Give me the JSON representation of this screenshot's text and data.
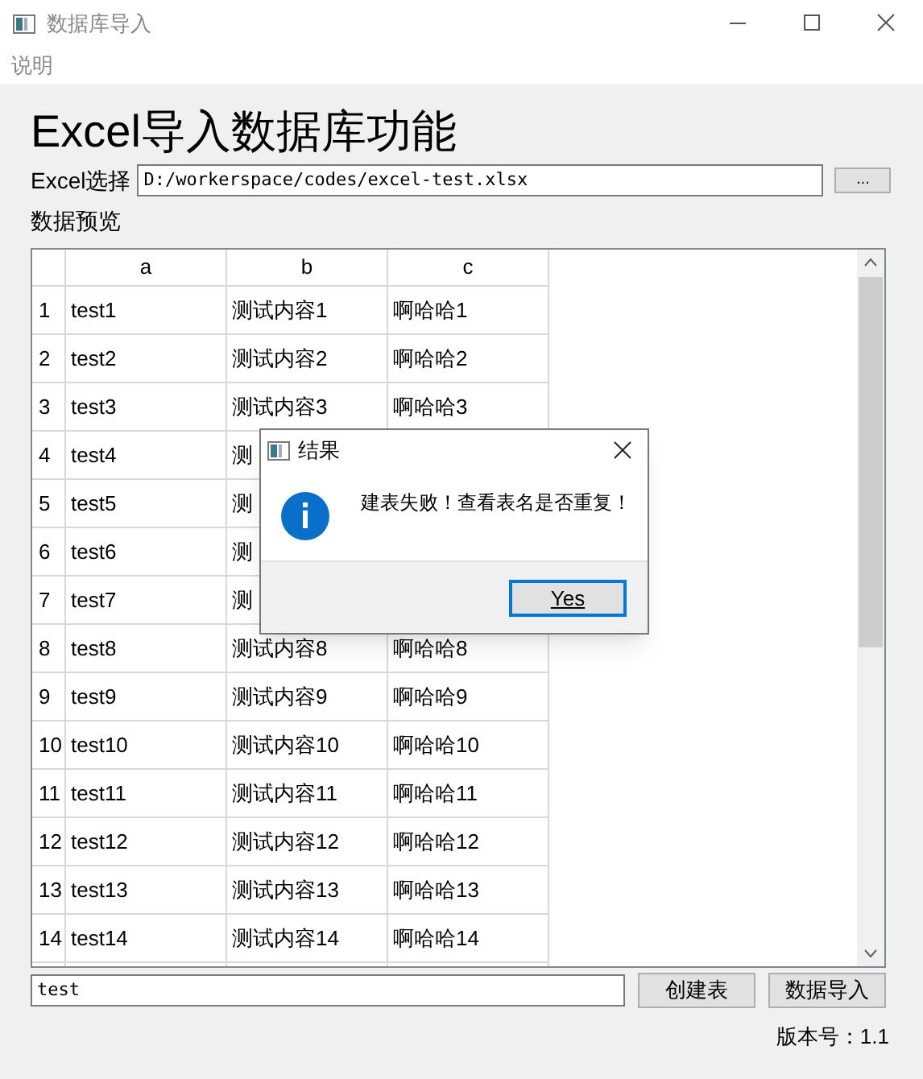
{
  "window": {
    "title": "数据库导入"
  },
  "menu": [
    "说明"
  ],
  "heading": "Excel导入数据库功能",
  "file_picker": {
    "label": "Excel选择",
    "value": "D:/workerspace/codes/excel-test.xlsx",
    "browse_button": "..."
  },
  "preview_label": "数据预览",
  "table": {
    "columns": [
      "a",
      "b",
      "c"
    ],
    "rows": [
      {
        "number": "1",
        "cells": [
          "test1",
          "测试内容1",
          "啊哈哈1"
        ]
      },
      {
        "number": "2",
        "cells": [
          "test2",
          "测试内容2",
          "啊哈哈2"
        ]
      },
      {
        "number": "3",
        "cells": [
          "test3",
          "测试内容3",
          "啊哈哈3"
        ]
      },
      {
        "number": "4",
        "cells": [
          "test4",
          "测"
        ]
      },
      {
        "number": "5",
        "cells": [
          "test5",
          "测"
        ]
      },
      {
        "number": "6",
        "cells": [
          "test6",
          "测"
        ]
      },
      {
        "number": "7",
        "cells": [
          "test7",
          "测"
        ]
      },
      {
        "number": "8",
        "cells": [
          "test8",
          "测试内容8",
          "啊哈哈8"
        ]
      },
      {
        "number": "9",
        "cells": [
          "test9",
          "测试内容9",
          "啊哈哈9"
        ]
      },
      {
        "number": "10",
        "cells": [
          "test10",
          "测试内容10",
          "啊哈哈10"
        ]
      },
      {
        "number": "11",
        "cells": [
          "test11",
          "测试内容11",
          "啊哈哈11"
        ]
      },
      {
        "number": "12",
        "cells": [
          "test12",
          "测试内容12",
          "啊哈哈12"
        ]
      },
      {
        "number": "13",
        "cells": [
          "test13",
          "测试内容13",
          "啊哈哈13"
        ]
      },
      {
        "number": "14",
        "cells": [
          "test14",
          "测试内容14",
          "啊哈哈14"
        ]
      }
    ]
  },
  "table_name_field": {
    "value": "test"
  },
  "buttons": [
    "创建表",
    "数据导入"
  ],
  "version": "版本号：1.1",
  "dialog": {
    "title": "结果",
    "message": "建表失败！查看表名是否重复！",
    "button": "Yes"
  }
}
